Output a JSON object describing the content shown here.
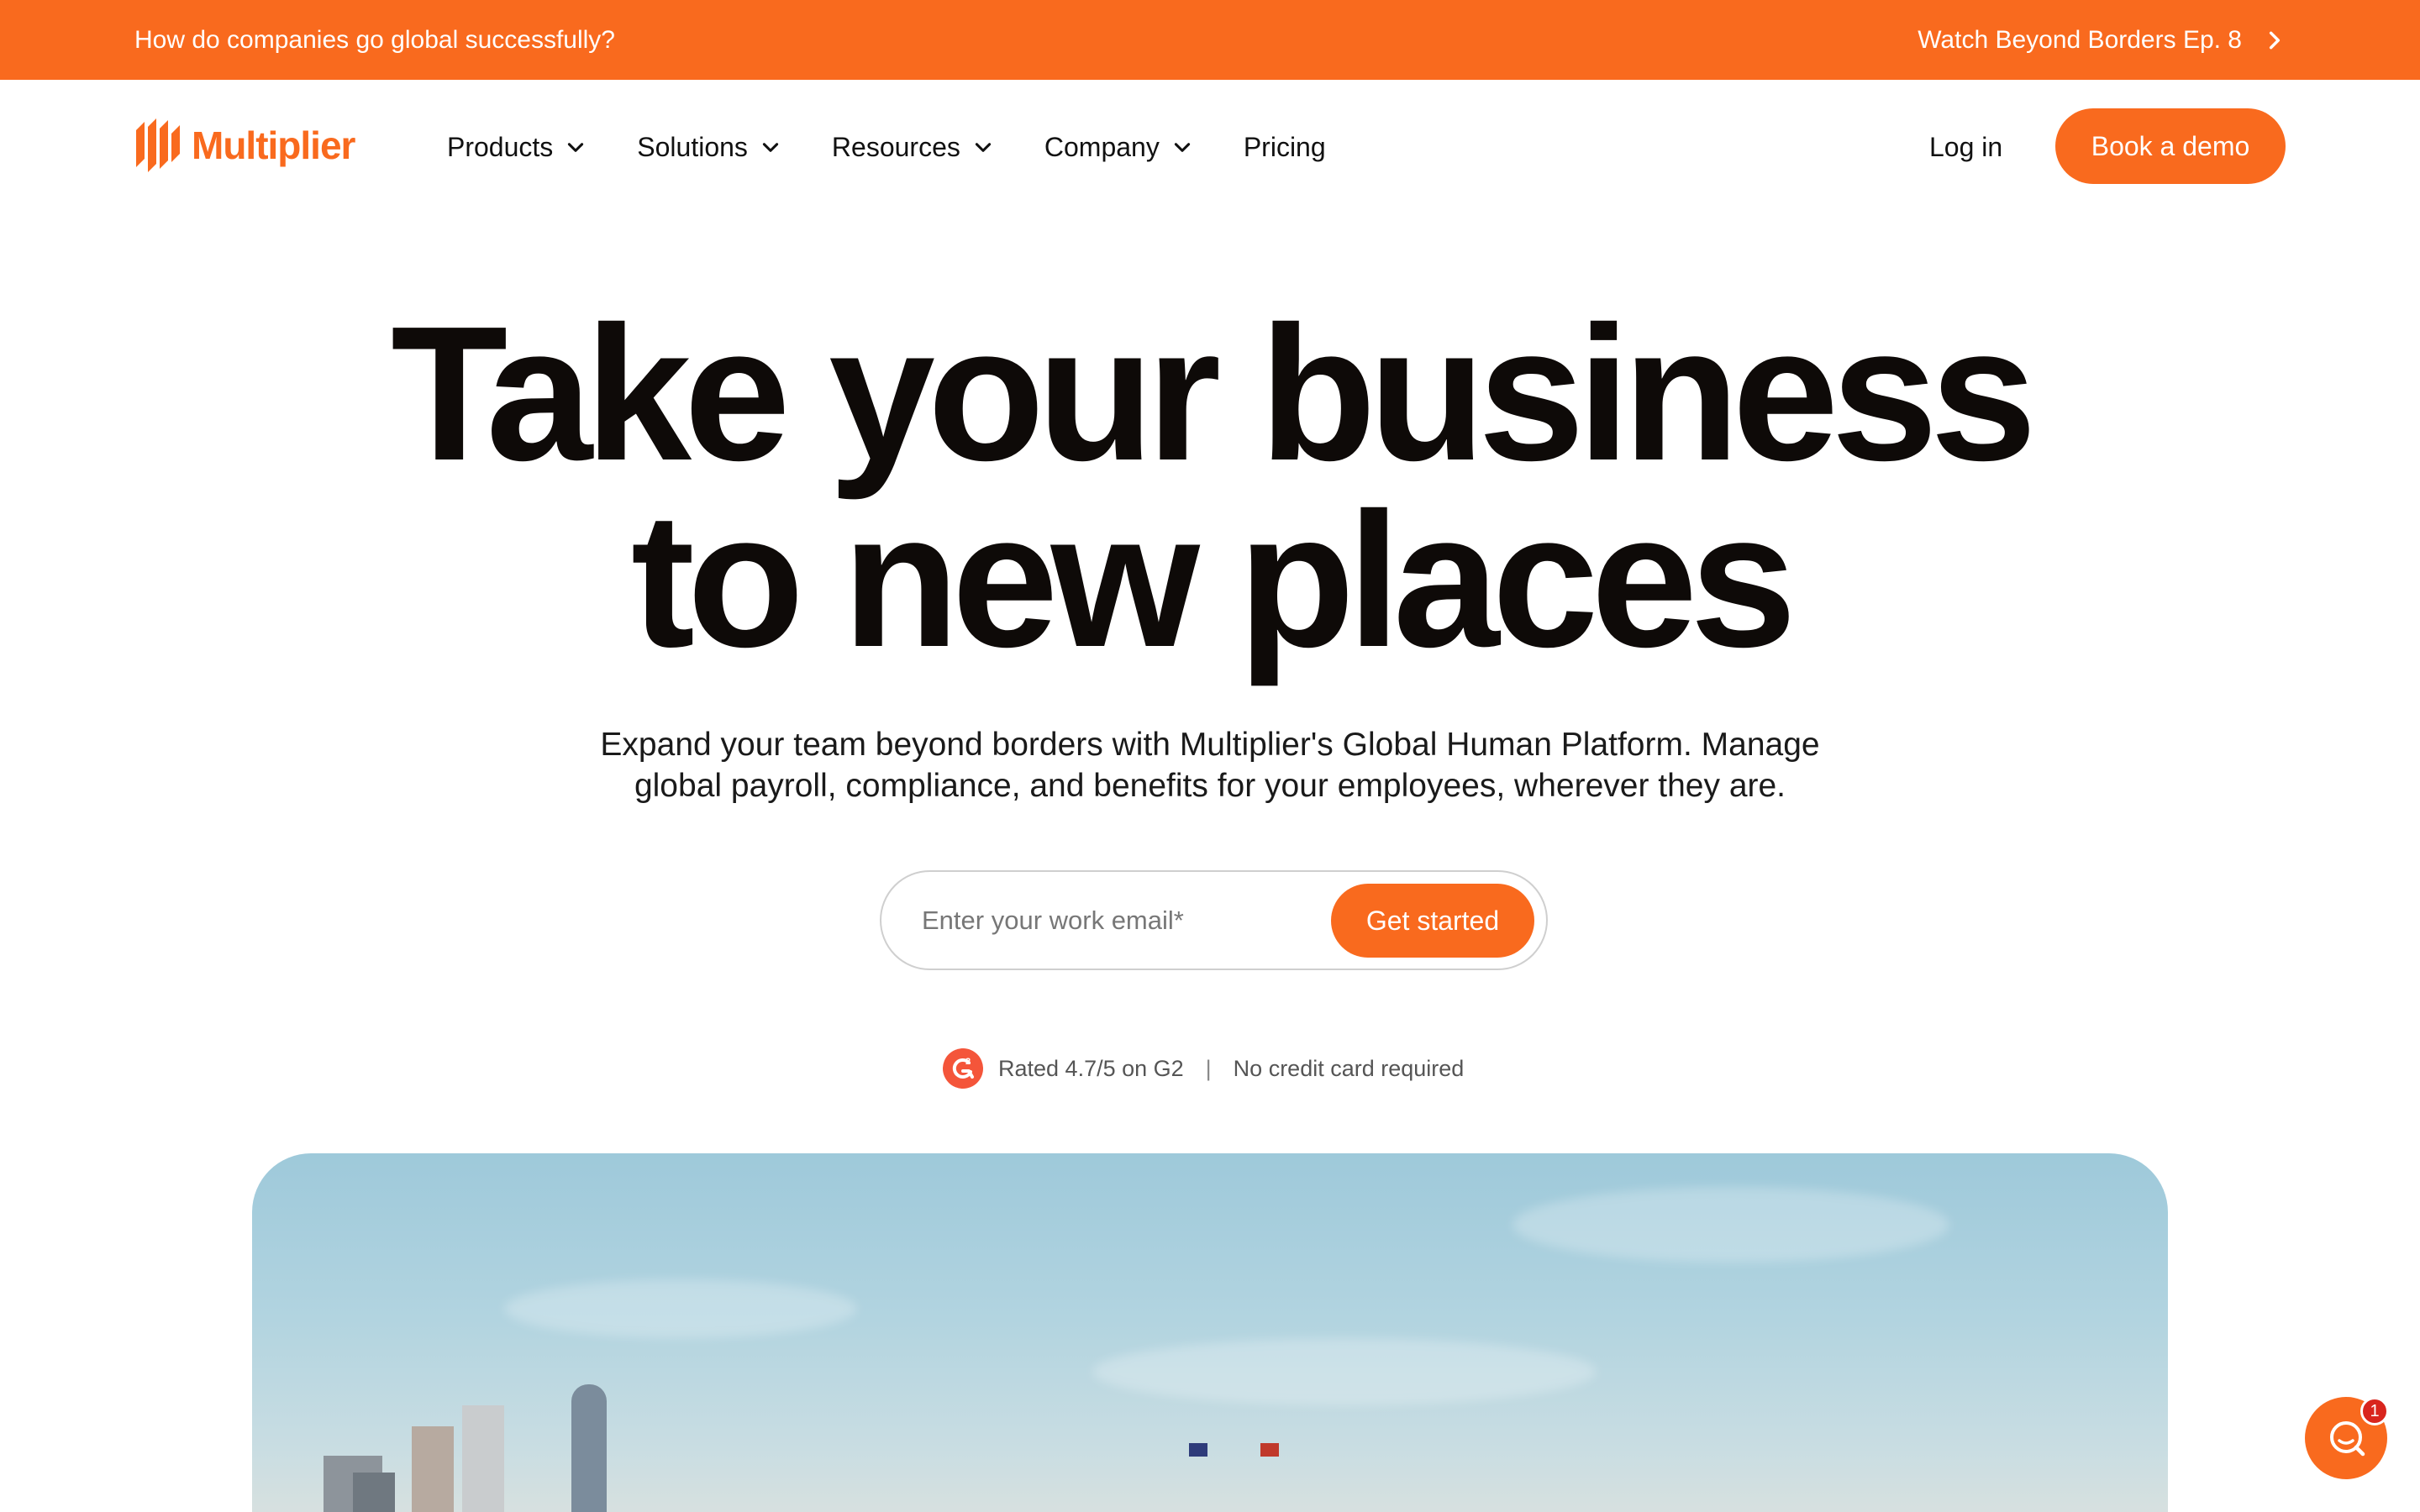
{
  "announcement": {
    "question": "How do companies go global successfully?",
    "cta_label": "Watch Beyond Borders Ep. 8",
    "cta_icon": "chevron-right-icon"
  },
  "nav": {
    "logo_text": "Multiplier",
    "menu": [
      {
        "label": "Products",
        "icon": "chevron-down-icon"
      },
      {
        "label": "Solutions",
        "icon": "chevron-down-icon"
      },
      {
        "label": "Resources",
        "icon": "chevron-down-icon"
      },
      {
        "label": "Company",
        "icon": "chevron-down-icon"
      },
      {
        "label": "Pricing"
      }
    ],
    "login_label": "Log in",
    "demo_label": "Book a demo"
  },
  "hero": {
    "title_line1": "Take your business",
    "title_line2": "to new places",
    "subtitle_line1": "Expand your team beyond borders with Multiplier's Global Human Platform. Manage",
    "subtitle_line2": "global payroll, compliance, and benefits for your employees, wherever they are.",
    "email_placeholder": "Enter your work email*",
    "email_value": "",
    "cta_label": "Get started"
  },
  "trust": {
    "rating_text": "Rated 4.7/5 on G2",
    "separator": "|",
    "note": "No credit card required",
    "icon": "g2-logo-icon"
  },
  "chat_widget": {
    "icon": "chat-search-icon",
    "badge_count": "1"
  },
  "colors": {
    "brand_orange": "#f96a1e",
    "badge_red": "#d9251d",
    "text_dark": "#0e0a08"
  }
}
